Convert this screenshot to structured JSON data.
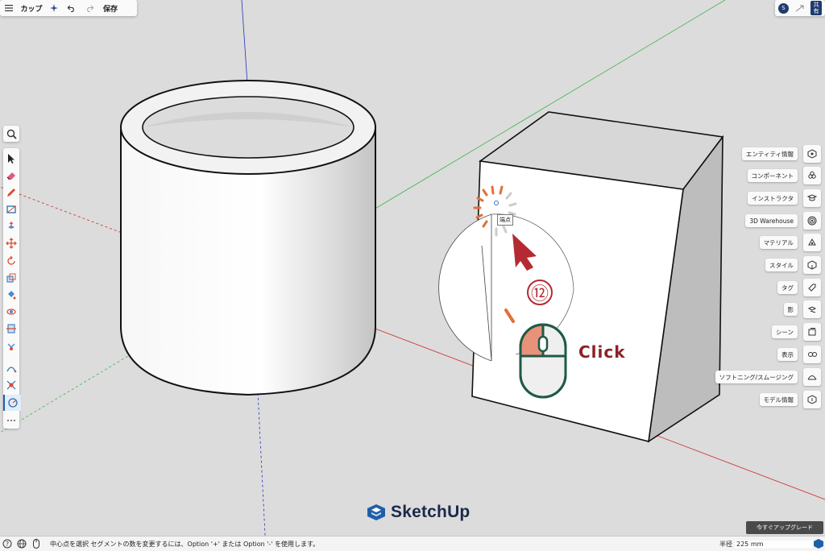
{
  "toolbar": {
    "menu_icon": "hamburger-menu-icon",
    "model_name": "カップ",
    "save_label": "保存"
  },
  "top_right": {
    "avatar_letter": "S",
    "share_label_top": "共",
    "share_label_bottom": "有"
  },
  "tools": [
    {
      "name": "select-tool",
      "icon": "arrow-icon"
    },
    {
      "name": "eraser-tool",
      "icon": "eraser-icon"
    },
    {
      "name": "pencil-tool",
      "icon": "pencil-icon"
    },
    {
      "name": "rectangle-tool",
      "icon": "rectangle-icon"
    },
    {
      "name": "push-pull-tool",
      "icon": "push-pull-icon"
    },
    {
      "name": "move-tool",
      "icon": "move-icon"
    },
    {
      "name": "rotate-tool",
      "icon": "rotate-icon"
    },
    {
      "name": "scale-tool",
      "icon": "scale-icon"
    },
    {
      "name": "paint-bucket-tool",
      "icon": "paint-bucket-icon"
    },
    {
      "name": "orbit-tool",
      "icon": "orbit-icon"
    },
    {
      "name": "section-tool",
      "icon": "section-icon"
    },
    {
      "name": "tape-measure-tool",
      "icon": "tape-measure-icon"
    },
    {
      "name": "arc-tool",
      "icon": "arc-icon"
    },
    {
      "name": "zoom-extents-tool",
      "icon": "zoom-extents-icon"
    },
    {
      "name": "circle-tool",
      "icon": "circle-icon"
    },
    {
      "name": "more-tools",
      "icon": "ellipsis-icon"
    }
  ],
  "right_panel": [
    {
      "label": "エンティティ情報",
      "icon": "entity-info-icon"
    },
    {
      "label": "コンポーネント",
      "icon": "components-icon"
    },
    {
      "label": "インストラクタ",
      "icon": "instructor-icon"
    },
    {
      "label": "3D Warehouse",
      "icon": "warehouse-icon"
    },
    {
      "label": "マテリアル",
      "icon": "materials-icon"
    },
    {
      "label": "スタイル",
      "icon": "styles-icon"
    },
    {
      "label": "タグ",
      "icon": "tags-icon"
    },
    {
      "label": "影",
      "icon": "shadows-icon"
    },
    {
      "label": "シーン",
      "icon": "scenes-icon"
    },
    {
      "label": "表示",
      "icon": "display-icon"
    },
    {
      "label": "ソフトニング/スムージング",
      "icon": "soften-icon"
    },
    {
      "label": "モデル情報",
      "icon": "model-info-icon"
    }
  ],
  "viewport": {
    "vertex_tooltip": "端点",
    "step_number": "⑫",
    "click_label": "Click",
    "logo_text": "SketchUp"
  },
  "status_bar": {
    "message": "中心点を選択 セグメントの数を変更するには、Option '+' または Option '-' を使用します。",
    "radius_label": "半径",
    "radius_value": "225 mm",
    "upgrade_label": "今すぐアップグレード"
  },
  "colors": {
    "accent": "#1f3b6e",
    "annotation_red": "#8b2326",
    "annotation_orange": "#e0703a"
  }
}
